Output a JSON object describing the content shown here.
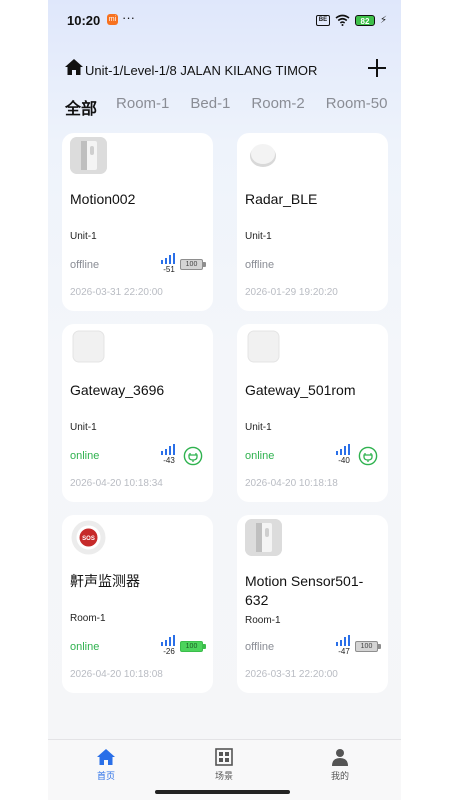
{
  "status_bar": {
    "time": "10:20",
    "app_badge": "mi",
    "dots": "···",
    "vpn": "BE",
    "battery": "82",
    "bolt": "⚡"
  },
  "header": {
    "title": "Unit-1/Level-1/8 JALAN KILANG TIMOR",
    "home_icon": "home-icon",
    "add_icon": "plus-icon"
  },
  "tabs": [
    {
      "label": "全部",
      "active": true
    },
    {
      "label": "Room-1"
    },
    {
      "label": "Bed-1"
    },
    {
      "label": "Room-2"
    },
    {
      "label": "Room-50"
    }
  ],
  "devices": [
    {
      "name": "Motion002",
      "room": "Unit-1",
      "status": "offline",
      "signal": "-51",
      "battery": "100",
      "battery_full": false,
      "power": "battery",
      "time": "2026-03-31 22:20:00",
      "thumb": "motion-sensor-icon"
    },
    {
      "name": "Radar_BLE",
      "room": "Unit-1",
      "status": "offline",
      "time": "2026-01-29 19:20:20",
      "thumb": "radar-icon"
    },
    {
      "name": "Gateway_3696",
      "room": "Unit-1",
      "status": "online",
      "signal": "-43",
      "power": "plug",
      "time": "2026-04-20 10:18:34",
      "thumb": "gateway-icon"
    },
    {
      "name": "Gateway_501rom",
      "room": "Unit-1",
      "status": "online",
      "signal": "-40",
      "power": "plug",
      "time": "2026-04-20 10:18:18",
      "thumb": "gateway-icon"
    },
    {
      "name": "鼾声监测器",
      "room": "Room-1",
      "status": "online",
      "signal": "-26",
      "battery": "100",
      "battery_full": true,
      "power": "battery",
      "time": "2026-04-20 10:18:08",
      "thumb": "sos-button-icon",
      "thumb_text": "SOS"
    },
    {
      "name": "Motion Sensor501-632",
      "room": "Room-1",
      "status": "offline",
      "signal": "-47",
      "battery": "100",
      "battery_full": false,
      "power": "battery",
      "time": "2026-03-31 22:20:00",
      "thumb": "motion-sensor-icon"
    }
  ],
  "nav": [
    {
      "label": "首页",
      "icon": "home-icon",
      "active": true
    },
    {
      "label": "场景",
      "icon": "scene-icon"
    },
    {
      "label": "我的",
      "icon": "person-icon"
    }
  ],
  "colors": {
    "accent": "#2a6fe8",
    "online": "#2fb24f",
    "offline": "#8a8d95",
    "signal": "#2a6fe8"
  }
}
